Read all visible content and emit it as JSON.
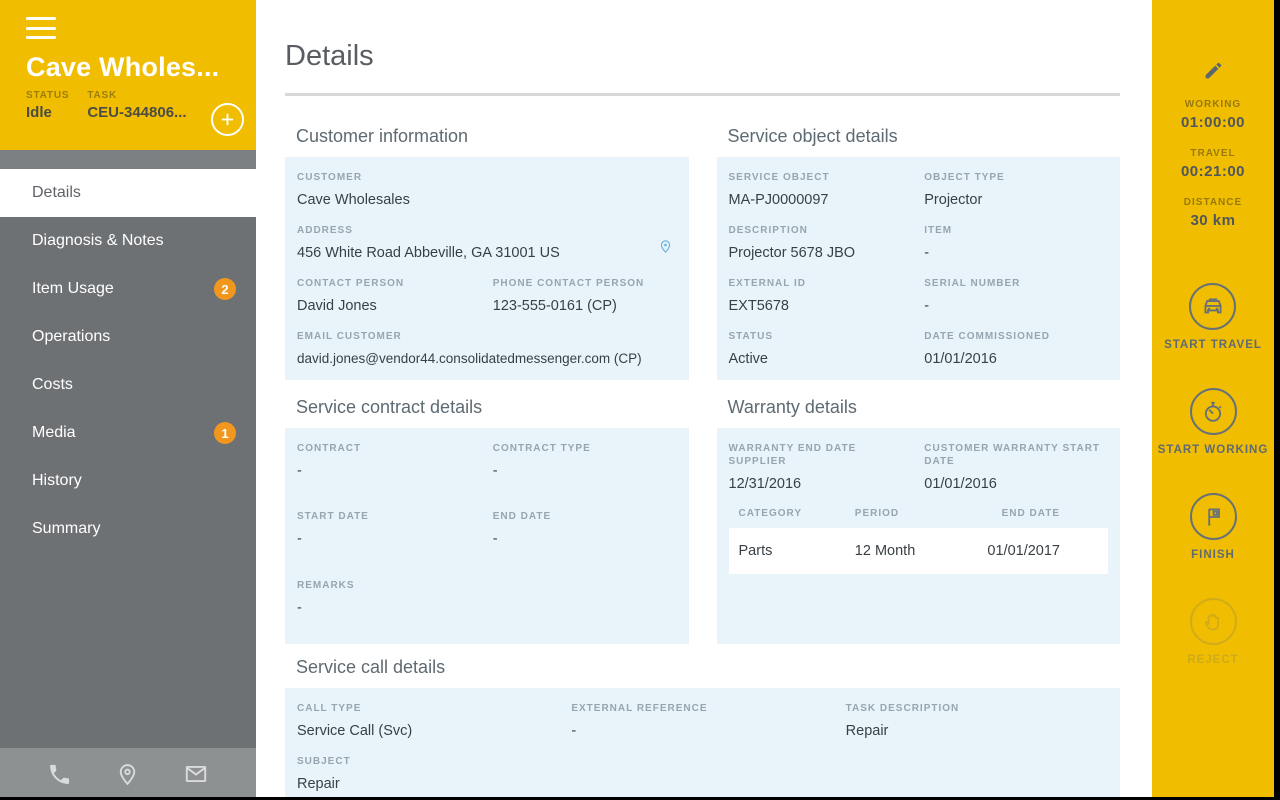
{
  "colors": {
    "brand_yellow": "#f0bd00",
    "sidebar_gray": "#6d7174",
    "badge_orange": "#f2971e",
    "panel_blue": "#e9f4fa",
    "text_dark": "#394045",
    "label_gray": "#96a5af",
    "pin_blue": "#6fb8dc"
  },
  "icons": {
    "menu": "hamburger-icon",
    "add": "plus-circle-icon",
    "phone": "phone-icon",
    "location": "location-pin-icon",
    "email": "envelope-icon",
    "edit": "pencil-icon",
    "start_travel": "car-icon",
    "start_working": "stopwatch-icon",
    "finish": "flag-icon",
    "reject": "hand-icon"
  },
  "left_sidebar": {
    "title": "Cave Wholes...",
    "status_label": "STATUS",
    "status_value": "Idle",
    "task_label": "TASK",
    "task_value": "CEU-344806...",
    "nav": [
      {
        "label": "Details",
        "badge": ""
      },
      {
        "label": "Diagnosis & Notes",
        "badge": ""
      },
      {
        "label": "Item Usage",
        "badge": "2"
      },
      {
        "label": "Operations",
        "badge": ""
      },
      {
        "label": "Costs",
        "badge": ""
      },
      {
        "label": "Media",
        "badge": "1"
      },
      {
        "label": "History",
        "badge": ""
      },
      {
        "label": "Summary",
        "badge": ""
      }
    ]
  },
  "main": {
    "title": "Details",
    "customer_info": {
      "title": "Customer information",
      "customer_label": "CUSTOMER",
      "customer_value": "Cave Wholesales",
      "address_label": "ADDRESS",
      "address_value": "456 White Road Abbeville, GA 31001 US",
      "contact_label": "CONTACT PERSON",
      "contact_value": "David Jones",
      "phone_label": "PHONE CONTACT PERSON",
      "phone_value": "123-555-0161 (CP)",
      "email_label": "EMAIL CUSTOMER",
      "email_value": "david.jones@vendor44.consolidatedmessenger.com (CP)"
    },
    "service_object": {
      "title": "Service object details",
      "fields": [
        {
          "label": "SERVICE OBJECT",
          "value": "MA-PJ0000097"
        },
        {
          "label": "OBJECT TYPE",
          "value": "Projector"
        },
        {
          "label": "DESCRIPTION",
          "value": "Projector 5678 JBO"
        },
        {
          "label": "ITEM",
          "value": "-"
        },
        {
          "label": "EXTERNAL ID",
          "value": "EXT5678"
        },
        {
          "label": "SERIAL NUMBER",
          "value": "-"
        },
        {
          "label": "STATUS",
          "value": "Active"
        },
        {
          "label": "DATE COMMISSIONED",
          "value": "01/01/2016"
        }
      ]
    },
    "contract": {
      "title": "Service contract details",
      "fields": [
        {
          "label": "CONTRACT",
          "value": "-"
        },
        {
          "label": "CONTRACT TYPE",
          "value": "-"
        },
        {
          "label": "START DATE",
          "value": "-"
        },
        {
          "label": "END DATE",
          "value": "-"
        },
        {
          "label": "REMARKS",
          "value": "-"
        }
      ]
    },
    "warranty": {
      "title": "Warranty details",
      "supplier_label": "WARRANTY END DATE SUPPLIER",
      "supplier_value": "12/31/2016",
      "customer_start_label": "CUSTOMER WARRANTY START DATE",
      "customer_start_value": "01/01/2016",
      "table": {
        "headers": [
          "CATEGORY",
          "PERIOD",
          "END DATE"
        ],
        "rows": [
          [
            "Parts",
            "12 Month",
            "01/01/2017"
          ]
        ]
      }
    },
    "service_call": {
      "title": "Service call details",
      "call_type_label": "CALL TYPE",
      "call_type_value": "Service Call (Svc)",
      "external_ref_label": "EXTERNAL REFERENCE",
      "external_ref_value": "-",
      "task_desc_label": "TASK DESCRIPTION",
      "task_desc_value": "Repair",
      "subject_label": "SUBJECT",
      "subject_value": "Repair"
    }
  },
  "right_sidebar": {
    "working_label": "WORKING",
    "working_value": "01:00:00",
    "travel_label": "TRAVEL",
    "travel_value": "00:21:00",
    "distance_label": "DISTANCE",
    "distance_value": "30 km",
    "actions": [
      {
        "label": "START TRAVEL"
      },
      {
        "label": "START WORKING"
      },
      {
        "label": "FINISH"
      },
      {
        "label": "REJECT"
      }
    ]
  }
}
